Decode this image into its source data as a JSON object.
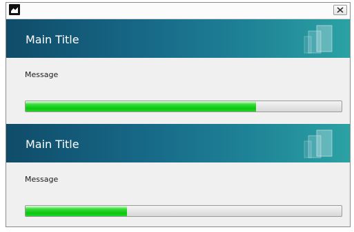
{
  "window": {
    "icon": "app-icon",
    "close_label": "close"
  },
  "panels": [
    {
      "title": "Main Title",
      "message": "Message",
      "progress": 0.73
    },
    {
      "title": "Main Title",
      "message": "Message",
      "progress": 0.32
    }
  ],
  "colors": {
    "banner_start": "#0f4c69",
    "banner_end": "#2ba2a3",
    "progress_fill": "#0bc50f",
    "background": "#f0f0f0"
  }
}
